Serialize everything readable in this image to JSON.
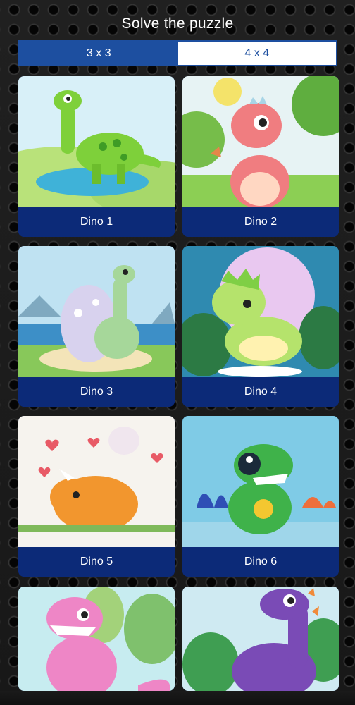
{
  "header": {
    "title": "Solve the puzzle"
  },
  "tabs": [
    {
      "label": "3 x 3",
      "active": true
    },
    {
      "label": "4 x 4",
      "active": false
    }
  ],
  "puzzles": [
    {
      "label": "Dino 1"
    },
    {
      "label": "Dino 2"
    },
    {
      "label": "Dino 3"
    },
    {
      "label": "Dino 4"
    },
    {
      "label": "Dino 5"
    },
    {
      "label": "Dino 6"
    }
  ],
  "colors": {
    "accent": "#1d4fa0",
    "card_label_bg": "#0c2a78",
    "background": "#141414"
  }
}
